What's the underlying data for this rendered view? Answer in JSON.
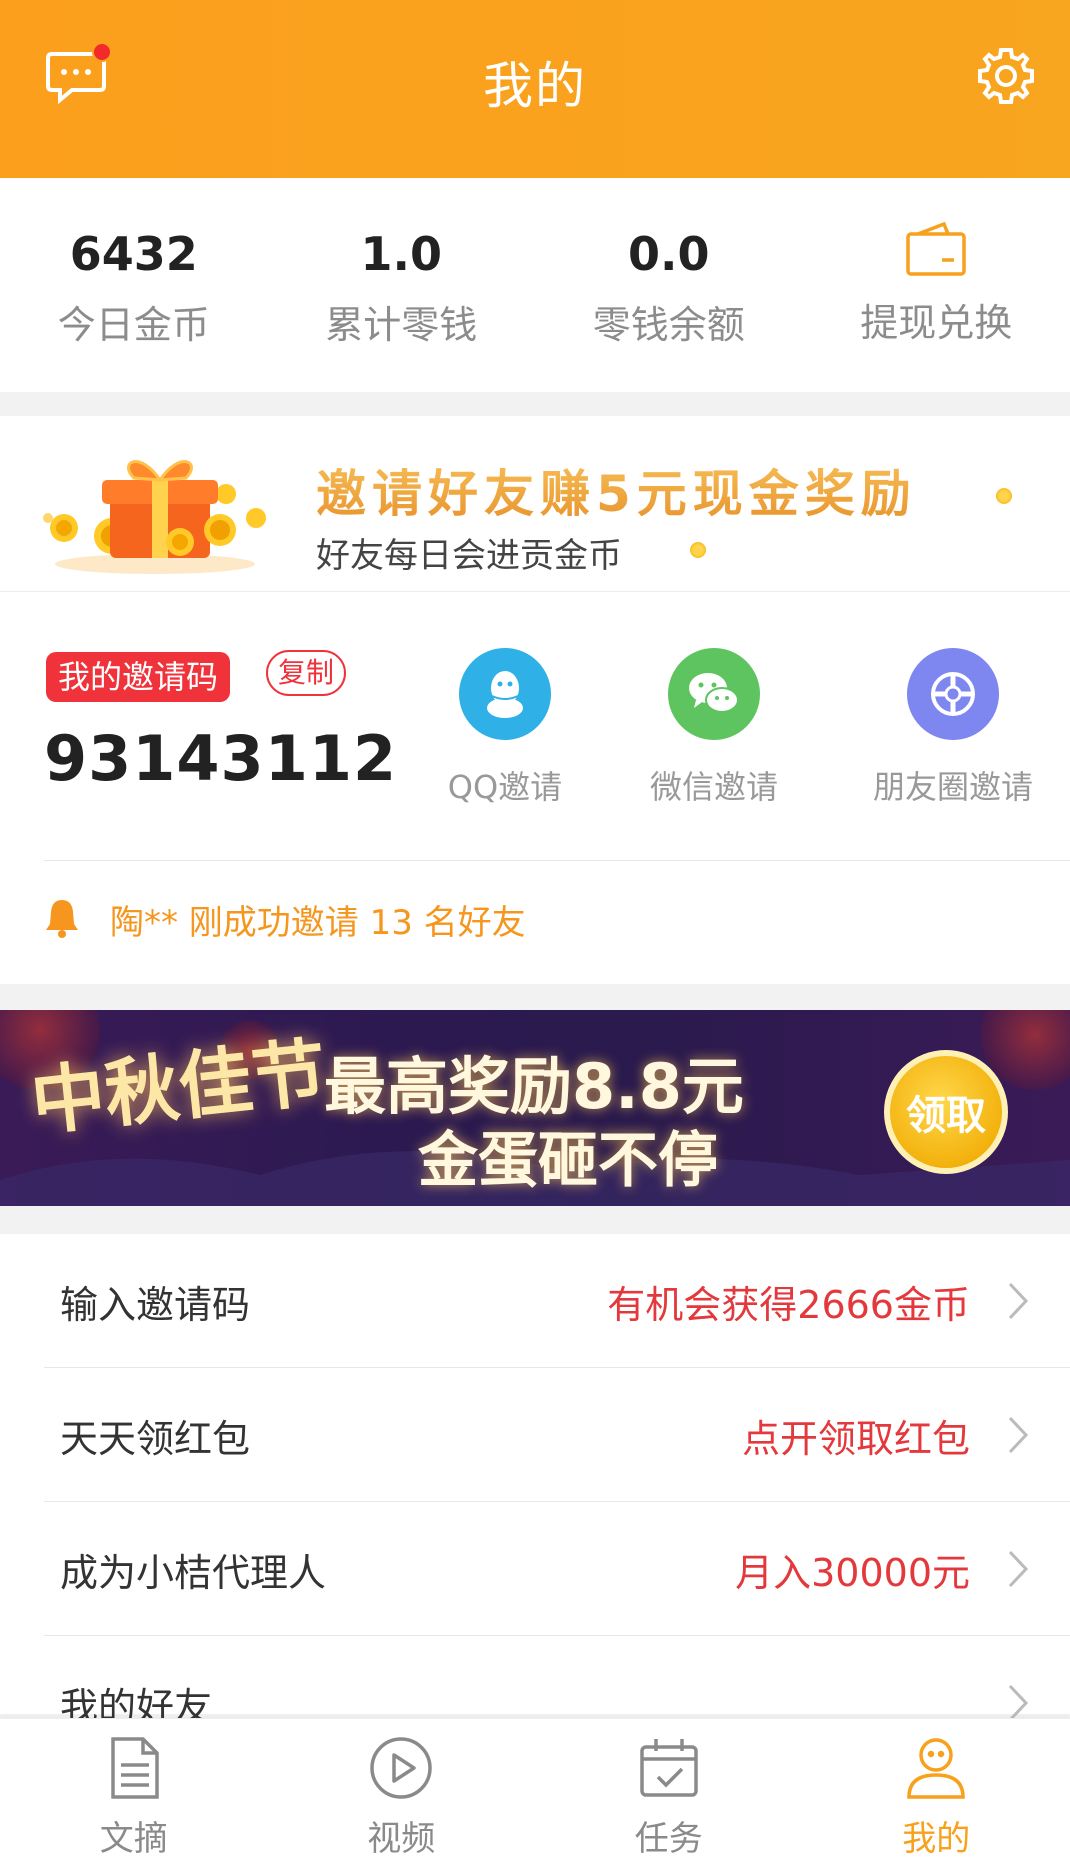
{
  "header": {
    "title": "我的"
  },
  "stats": [
    {
      "value": "6432",
      "label": "今日金币"
    },
    {
      "value": "1.0",
      "label": "累计零钱"
    },
    {
      "value": "0.0",
      "label": "零钱余额"
    },
    {
      "label": "提现兑换",
      "icon": "wallet-icon"
    }
  ],
  "invite_banner": {
    "title": "邀请好友赚5元现金奖励",
    "subtitle": "好友每日会进贡金币"
  },
  "invite_code": {
    "tag": "我的邀请码",
    "copy_label": "复制",
    "code": "93143112",
    "shares": [
      {
        "label": "QQ邀请",
        "icon": "qq-icon",
        "color": "#2fb0e6"
      },
      {
        "label": "微信邀请",
        "icon": "wechat-icon",
        "color": "#5ec45f"
      },
      {
        "label": "朋友圈邀请",
        "icon": "moments-icon",
        "color": "#7e86f0"
      }
    ],
    "notice": "陶** 刚成功邀请 13 名好友"
  },
  "festival_banner": {
    "left_text": "中秋佳节",
    "line1": "最高奖励8.8元",
    "line2": "金蛋砸不停",
    "button": "领取"
  },
  "menu": [
    {
      "label": "输入邀请码",
      "value": "有机会获得2666金币"
    },
    {
      "label": "天天领红包",
      "value": "点开领取红包"
    },
    {
      "label": "成为小桔代理人",
      "value": "月入30000元"
    },
    {
      "label": "我的好友",
      "value": ""
    }
  ],
  "bottom_nav": [
    {
      "label": "文摘",
      "icon": "document-icon",
      "active": false
    },
    {
      "label": "视频",
      "icon": "play-icon",
      "active": false
    },
    {
      "label": "任务",
      "icon": "calendar-check-icon",
      "active": false
    },
    {
      "label": "我的",
      "icon": "user-icon",
      "active": true
    }
  ],
  "colors": {
    "accent": "#f7a11d",
    "red": "#e4393c",
    "header": "#fba01e"
  }
}
